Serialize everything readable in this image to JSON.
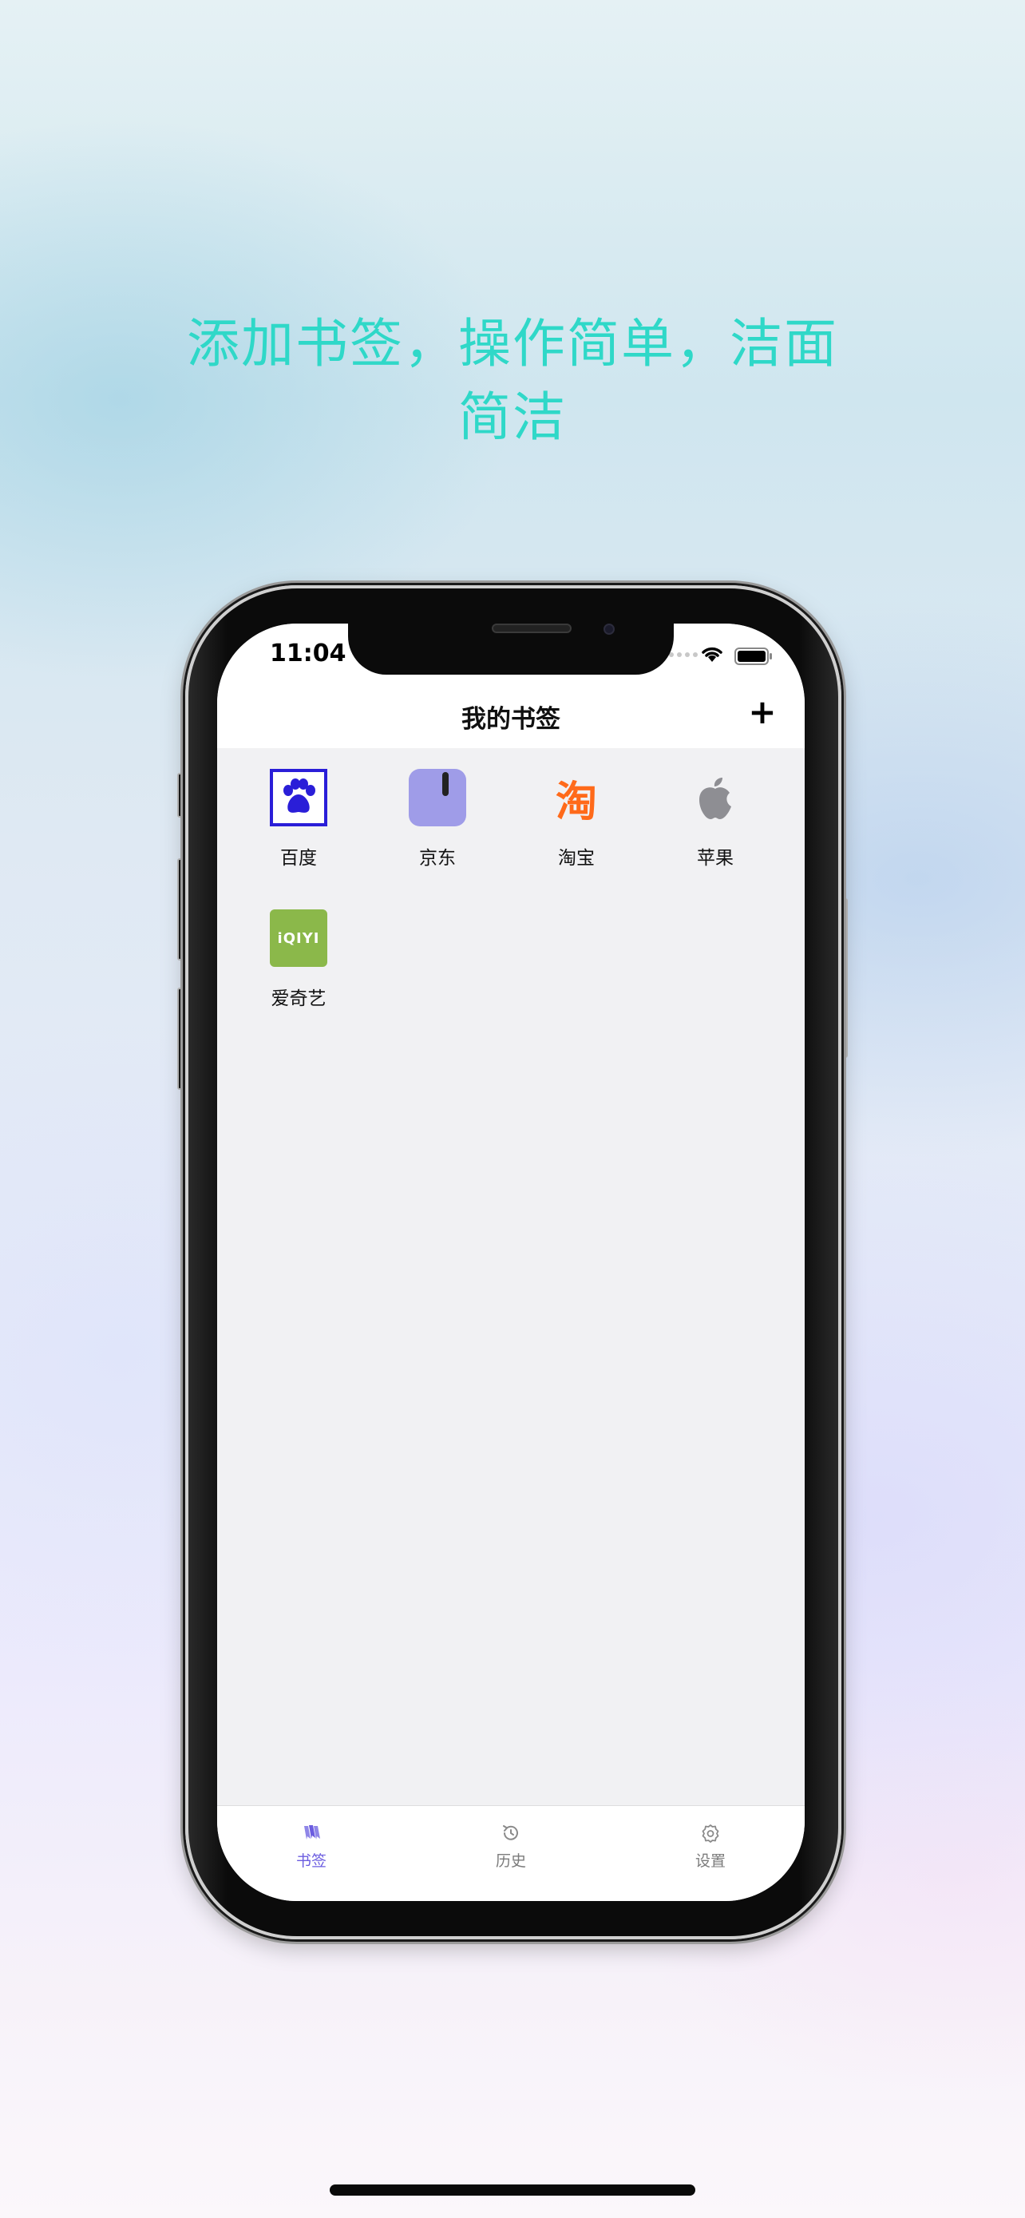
{
  "headline": {
    "line1": "添加书签，操作简单，洁面",
    "line2": "简洁"
  },
  "status_bar": {
    "time": "11:04"
  },
  "nav": {
    "title": "我的书签",
    "add_label": "+"
  },
  "bookmarks": [
    {
      "label": "百度",
      "icon": "baidu-paw-icon"
    },
    {
      "label": "京东",
      "icon": "jd-icon"
    },
    {
      "label": "淘宝",
      "icon": "taobao-icon",
      "glyph": "淘"
    },
    {
      "label": "苹果",
      "icon": "apple-icon"
    },
    {
      "label": "爱奇艺",
      "icon": "iqiyi-icon",
      "glyph": "iQIYI"
    }
  ],
  "tabs": [
    {
      "label": "书签",
      "icon": "bookmarks-icon",
      "active": true
    },
    {
      "label": "历史",
      "icon": "history-icon",
      "active": false
    },
    {
      "label": "设置",
      "icon": "settings-icon",
      "active": false
    }
  ],
  "colors": {
    "headline": "#2fd8c8",
    "accent": "#6b5ce0",
    "baidu": "#2a1ed8",
    "jd": "#9f9ce8",
    "taobao": "#ff6a1a",
    "apple": "#8e8e93",
    "iqiyi": "#8bb84a"
  }
}
